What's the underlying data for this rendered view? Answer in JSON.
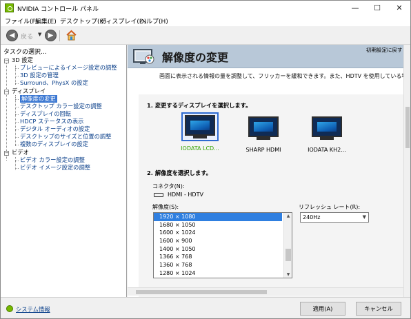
{
  "window": {
    "title": "NVIDIA コントロール パネル",
    "minimize": "—",
    "maximize": "☐",
    "close": "✕"
  },
  "menu": [
    "ファイル(F)",
    "編集(E)",
    "デスクトップ(K)",
    "ディスプレイ(D)",
    "ヘルプ(H)"
  ],
  "toolbar": {
    "back_label": "戻る"
  },
  "left_panel": {
    "title": "タスクの選択...",
    "tree": [
      {
        "label": "3D 設定",
        "kind": "head"
      },
      {
        "label": "プレビューによるイメージ設定の調整",
        "kind": "link"
      },
      {
        "label": "3D 設定の管理",
        "kind": "link"
      },
      {
        "label": "Surround、PhysX の設定",
        "kind": "link"
      },
      {
        "label": "ディスプレイ",
        "kind": "head"
      },
      {
        "label": "解像度の変更",
        "kind": "selected"
      },
      {
        "label": "デスクトップ カラー設定の調整",
        "kind": "link"
      },
      {
        "label": "ディスプレイの回転",
        "kind": "link"
      },
      {
        "label": "HDCP ステータスの表示",
        "kind": "link"
      },
      {
        "label": "デジタル オーディオの設定",
        "kind": "link"
      },
      {
        "label": "デスクトップのサイズと位置の調整",
        "kind": "link"
      },
      {
        "label": "複数のディスプレイの設定",
        "kind": "link"
      },
      {
        "label": "ビデオ",
        "kind": "head"
      },
      {
        "label": "ビデオ カラー設定の調整",
        "kind": "link"
      },
      {
        "label": "ビデオ イメージ設定の調整",
        "kind": "link"
      }
    ]
  },
  "main": {
    "title": "解像度の変更",
    "restore_defaults": "初期設定に戻す",
    "description": "画面に表示される情報の量を調整して、フリッカーを緩和できます。また、HDTV を使用している場合は高解",
    "section1_title": "1. 変更するディスプレイを選択します。",
    "displays": [
      {
        "label": "IODATA LCD...",
        "selected": true
      },
      {
        "label": "SHARP HDMI",
        "selected": false
      },
      {
        "label": "IODATA KH2...",
        "selected": false
      }
    ],
    "section2_title": "2. 解像度を選択します。",
    "connector_label": "コネクタ(N):",
    "connector_value": "HDMI - HDTV",
    "resolution_label": "解像度(S):",
    "resolutions": [
      "1920 × 1080",
      "1680 × 1050",
      "1600 × 1024",
      "1600 × 900",
      "1400 × 1050",
      "1366 × 768",
      "1360 × 768",
      "1280 × 1024"
    ],
    "selected_resolution": "1920 × 1080",
    "refresh_label": "リフレッシュ レート(R):",
    "refresh_value": "240Hz"
  },
  "bottom": {
    "system_info": "システム情報",
    "apply": "適用(A)",
    "cancel": "キャンセル"
  }
}
